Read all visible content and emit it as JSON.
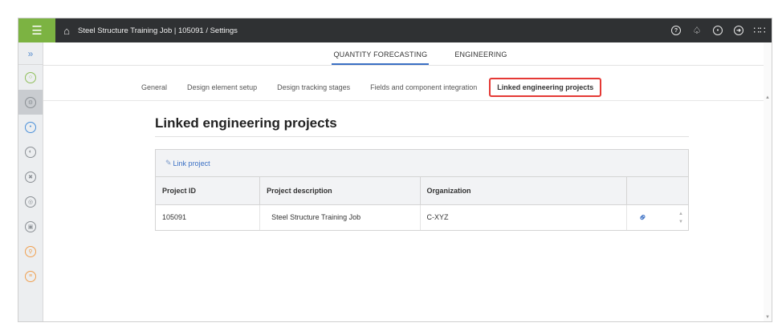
{
  "topbar": {
    "breadcrumb": "Steel Structure Training Job | 105091  /  Settings",
    "icons": [
      "help-icon",
      "bell-icon",
      "user-icon",
      "sign-out-icon",
      "apps-grid-icon"
    ]
  },
  "sidebar": {
    "items": [
      "dashboard-icon",
      "settings-icon",
      "target-icon",
      "progress-icon",
      "tools-icon",
      "drawing-icon",
      "document-icon",
      "search-icon",
      "report-icon"
    ]
  },
  "main_tabs": {
    "quantity": "QUANTITY FORECASTING",
    "engineering": "ENGINEERING"
  },
  "sub_tabs": {
    "general": "General",
    "design_element": "Design element setup",
    "tracking": "Design tracking stages",
    "fields": "Fields and component integration",
    "linked": "Linked engineering projects"
  },
  "page": {
    "title": "Linked engineering projects",
    "link_project": "Link project"
  },
  "table": {
    "headers": {
      "project_id": "Project ID",
      "description": "Project description",
      "organization": "Organization"
    },
    "rows": [
      {
        "project_id": "105091",
        "description": "Steel Structure Training Job",
        "organization": "C-XYZ"
      }
    ]
  },
  "colors": {
    "accent": "#7cb342",
    "topbar": "#2f3133",
    "link": "#3a6fc4",
    "highlight": "#e53935"
  }
}
